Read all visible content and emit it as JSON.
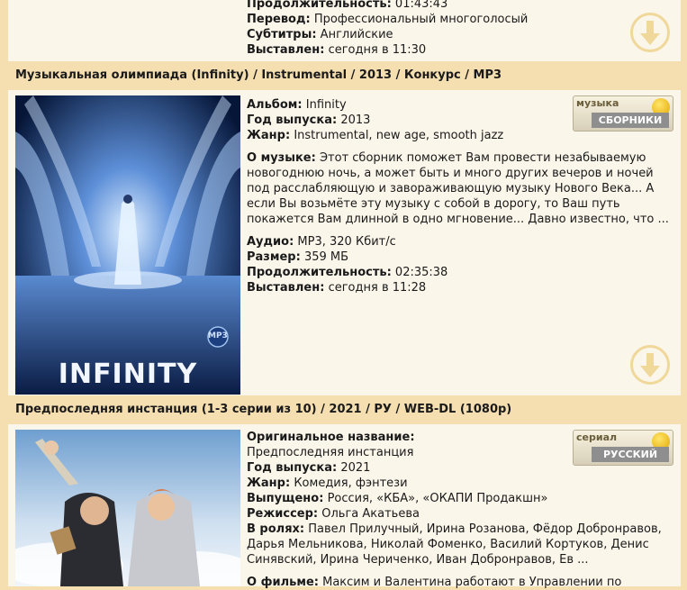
{
  "top_post": {
    "fields": [
      {
        "label": "Продолжительность:",
        "value": "01:43:43"
      },
      {
        "label": "Перевод:",
        "value": "Профессиональный многоголосый"
      },
      {
        "label": "Субтитры:",
        "value": "Английские"
      },
      {
        "label": "Выставлен:",
        "value": "сегодня в 11:30"
      }
    ]
  },
  "music_post": {
    "title": "Музыкальная олимпиада (Infinity) / Instrumental / 2013 / Конкурс / MP3",
    "poster_text": "INFINITY",
    "poster_badge": "MP3",
    "badge_top": "музыка",
    "badge_bottom": "СБОРНИКИ",
    "fields_top": [
      {
        "label": "Альбом:",
        "value": "Infinity"
      },
      {
        "label": "Год выпуска:",
        "value": "2013"
      },
      {
        "label": "Жанр:",
        "value": "Instrumental, new age, smooth jazz"
      }
    ],
    "about_label": "О музыке:",
    "about_text": "Этот сборник поможет Вам провести незабываемую новогоднюю ночь, а может быть и много других вечеров и ночей под расслабляющую и завораживающую музыку Нового Века... А если Вы возьмёте эту музыку с собой в дорогу, то Ваш путь покажется Вам длинной в одно мгновение... Давно известно, что ...",
    "fields_bottom": [
      {
        "label": "Аудио:",
        "value": "MP3, 320 Кбит/с"
      },
      {
        "label": "Размер:",
        "value": "359 МБ"
      },
      {
        "label": "Продолжительность:",
        "value": "02:35:38"
      },
      {
        "label": "Выставлен:",
        "value": "сегодня в 11:28"
      }
    ]
  },
  "series_post": {
    "title": "Предпоследняя инстанция (1-3 серии из 10) / 2021 / РУ / WEB-DL (1080p)",
    "badge_top": "сериал",
    "badge_bottom": "РУССКИЙ",
    "fields": [
      {
        "label": "Оригинальное название:",
        "value": "Предпоследняя инстанция"
      },
      {
        "label": "Год выпуска:",
        "value": "2021"
      },
      {
        "label": "Жанр:",
        "value": "Комедия, фэнтези"
      },
      {
        "label": "Выпущено:",
        "value": "Россия, «КБА», «ОКАПИ Продакшн»"
      },
      {
        "label": "Режиссер:",
        "value": "Ольга Акатьева"
      },
      {
        "label": "В ролях:",
        "value": "Павел Прилучный, Ирина Розанова, Фёдор Добронравов, Дарья Мельникова, Николай Фоменко, Василий Кортуков, Денис Синявский, Ирина Чериченко, Иван Добронравов, Ев ..."
      }
    ],
    "about_label": "О фильме:",
    "about_text": "Максим и Валентина работают в Управлении по"
  },
  "colors": {
    "frame": "#f5deb0",
    "card": "#fbf6ea",
    "download_ring": "#f0d79a"
  },
  "icons": {
    "download": "download-arrow-icon",
    "smiley": "smiley-icon"
  }
}
